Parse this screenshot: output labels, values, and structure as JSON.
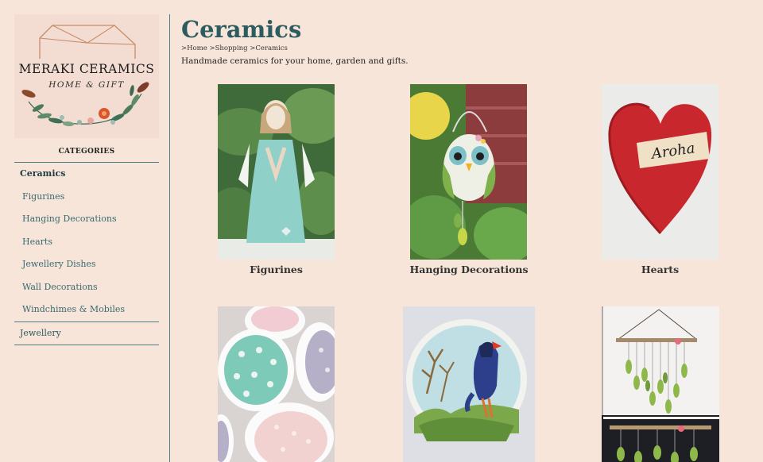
{
  "brand": {
    "name": "MERAKI CERAMICS",
    "tagline": "HOME & GIFT"
  },
  "sidebar": {
    "heading": "CATEGORIES",
    "items": [
      {
        "label": "Ceramics",
        "active": true
      },
      {
        "label": "Figurines"
      },
      {
        "label": "Hanging Decorations"
      },
      {
        "label": "Hearts"
      },
      {
        "label": "Jewellery Dishes"
      },
      {
        "label": "Wall Decorations"
      },
      {
        "label": "Windchimes & Mobiles"
      }
    ],
    "jewellery": "Jewellery"
  },
  "page": {
    "title": "Ceramics",
    "breadcrumb": [
      ">Home",
      ">Shopping",
      ">Ceramics"
    ],
    "description": "Handmade ceramics for your home, garden and gifts."
  },
  "products": [
    {
      "label": "Figurines",
      "image": "angel-figurine"
    },
    {
      "label": "Hanging Decorations",
      "image": "owl-hanging-decoration"
    },
    {
      "label": "Hearts",
      "image": "aroha-heart"
    },
    {
      "label": "",
      "image": "spotted-dishes"
    },
    {
      "label": "",
      "image": "bird-wall-plate"
    },
    {
      "label": "",
      "image": "leaf-windchime"
    }
  ],
  "heart_text": "Aroha",
  "colors": {
    "background": "#f7e5d9",
    "accent": "#2d5c60",
    "divider": "#4a7f86"
  }
}
